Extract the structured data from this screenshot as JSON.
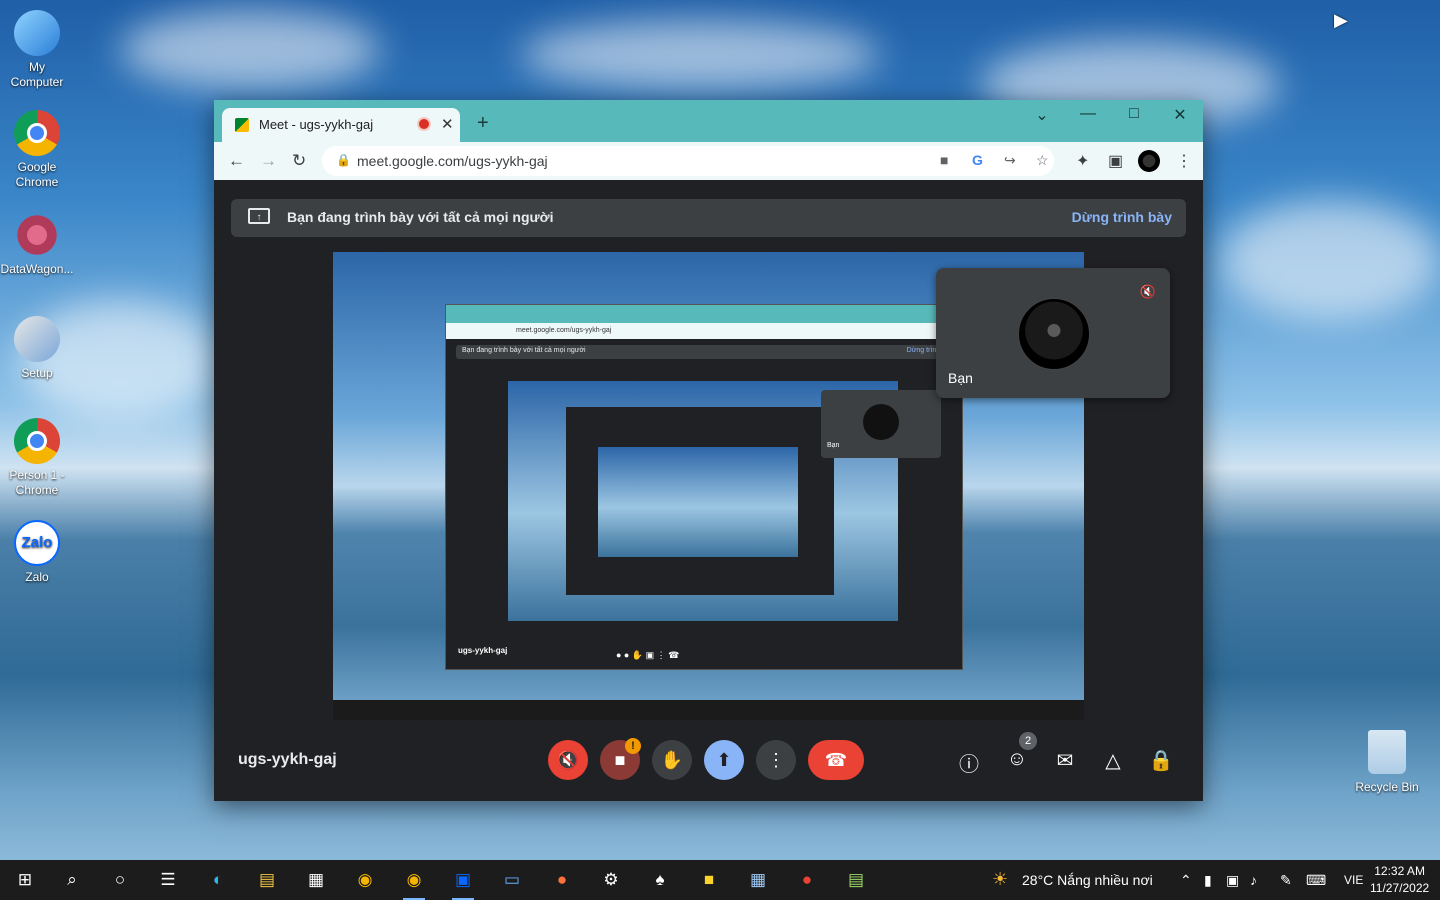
{
  "desktop": {
    "icons": [
      {
        "label": "My\nComputer",
        "icon": "computer-icon"
      },
      {
        "label": "Google\nChrome",
        "icon": "chrome-icon"
      },
      {
        "label": "DataWagon...",
        "icon": "datawagon-icon"
      },
      {
        "label": "Setup",
        "icon": "setup-icon"
      },
      {
        "label": "Person 1 -\nChrome",
        "icon": "chrome-person-icon"
      },
      {
        "label": "Zalo",
        "icon": "zalo-icon"
      }
    ],
    "recycle_bin": "Recycle Bin"
  },
  "browser": {
    "tab_title": "Meet - ugs-yykh-gaj",
    "url": "meet.google.com/ugs-yykh-gaj"
  },
  "meet": {
    "banner_text": "Bạn đang trình bày với tất cả mọi người",
    "stop_presenting": "Dừng trình bày",
    "meeting_code": "ugs-yykh-gaj",
    "self_tile_name": "Bạn",
    "participant_count": "2",
    "camera_warning": "!"
  },
  "mini_share": {
    "banner_text": "Bạn đang trình bày với tất cả mọi người",
    "stop_text": "Dừng trình b",
    "url": "meet.google.com/ugs-yykh-gaj",
    "meeting_code": "ugs-yykh-gaj",
    "self_tile_name": "Bạn"
  },
  "taskbar": {
    "weather": "28°C  Nắng nhiều nơi",
    "language": "VIE",
    "time": "12:32 AM",
    "date": "11/27/2022"
  },
  "colors": {
    "titlebar": "#58b9bb",
    "meet_bg": "#202124",
    "end_call": "#ea4335",
    "present_active": "#8ab4f8"
  }
}
